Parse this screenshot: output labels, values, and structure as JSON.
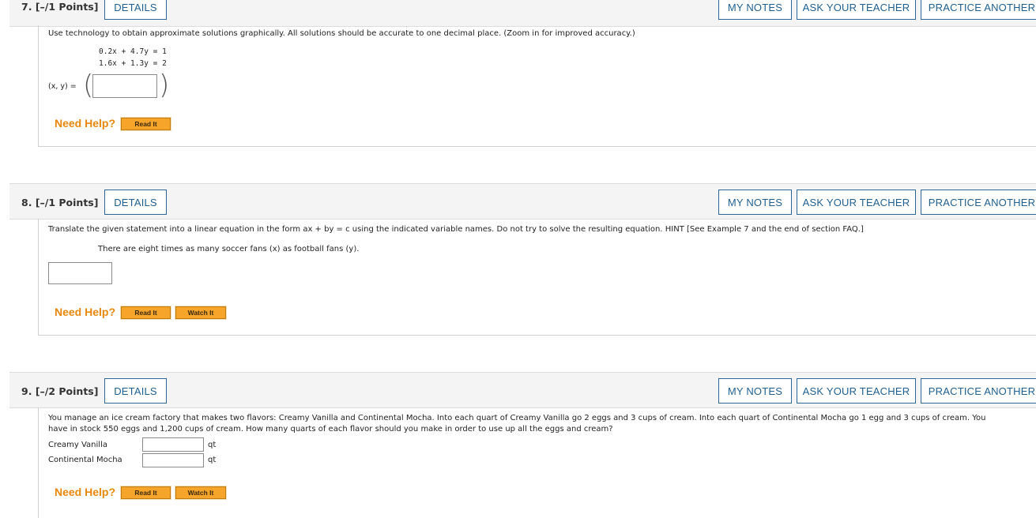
{
  "q7": {
    "number": "7.",
    "points": "[–/1 Points]",
    "details": "DETAILS",
    "my_notes": "MY NOTES",
    "ask_teacher": "ASK YOUR TEACHER",
    "practice": "PRACTICE ANOTHER",
    "prompt": "Use technology to obtain approximate solutions graphically. All solutions should be accurate to one decimal place. (Zoom in for improved accuracy.)",
    "eq1": "0.2x + 4.7y = 1",
    "eq2": "1.6x + 1.3y = 2",
    "answer_label": "(x, y) =",
    "answer_value": "",
    "need_help": "Need Help?",
    "read_it": "Read It"
  },
  "q8": {
    "number": "8.",
    "points": "[–/1 Points]",
    "details": "DETAILS",
    "my_notes": "MY NOTES",
    "ask_teacher": "ASK YOUR TEACHER",
    "practice": "PRACTICE ANOTHER",
    "prompt": "Translate the given statement into a linear equation in the form ax + by = c using the indicated variable names. Do not try to solve the resulting equation. HINT [See Example 7 and the end of section FAQ.]",
    "statement": "There are eight times as many soccer fans (x) as football fans (y).",
    "answer_value": "",
    "need_help": "Need Help?",
    "read_it": "Read It",
    "watch_it": "Watch It"
  },
  "q9": {
    "number": "9.",
    "points": "[–/2 Points]",
    "details": "DETAILS",
    "my_notes": "MY NOTES",
    "ask_teacher": "ASK YOUR TEACHER",
    "practice": "PRACTICE ANOTHER",
    "prompt_line1": "You manage an ice cream factory that makes two flavors: Creamy Vanilla and Continental Mocha. Into each quart of Creamy Vanilla go 2 eggs and 3 cups of cream. Into each quart of Continental Mocha go 1 egg and 3 cups of cream. You",
    "prompt_line2": "have in stock 550 eggs and 1,200 cups of cream. How many quarts of each flavor should you make in order to use up all the eggs and cream?",
    "row1_label": "Creamy Vanilla",
    "row2_label": "Continental Mocha",
    "unit": "qt",
    "row1_value": "",
    "row2_value": "",
    "need_help": "Need Help?",
    "read_it": "Read It",
    "watch_it": "Watch It"
  }
}
